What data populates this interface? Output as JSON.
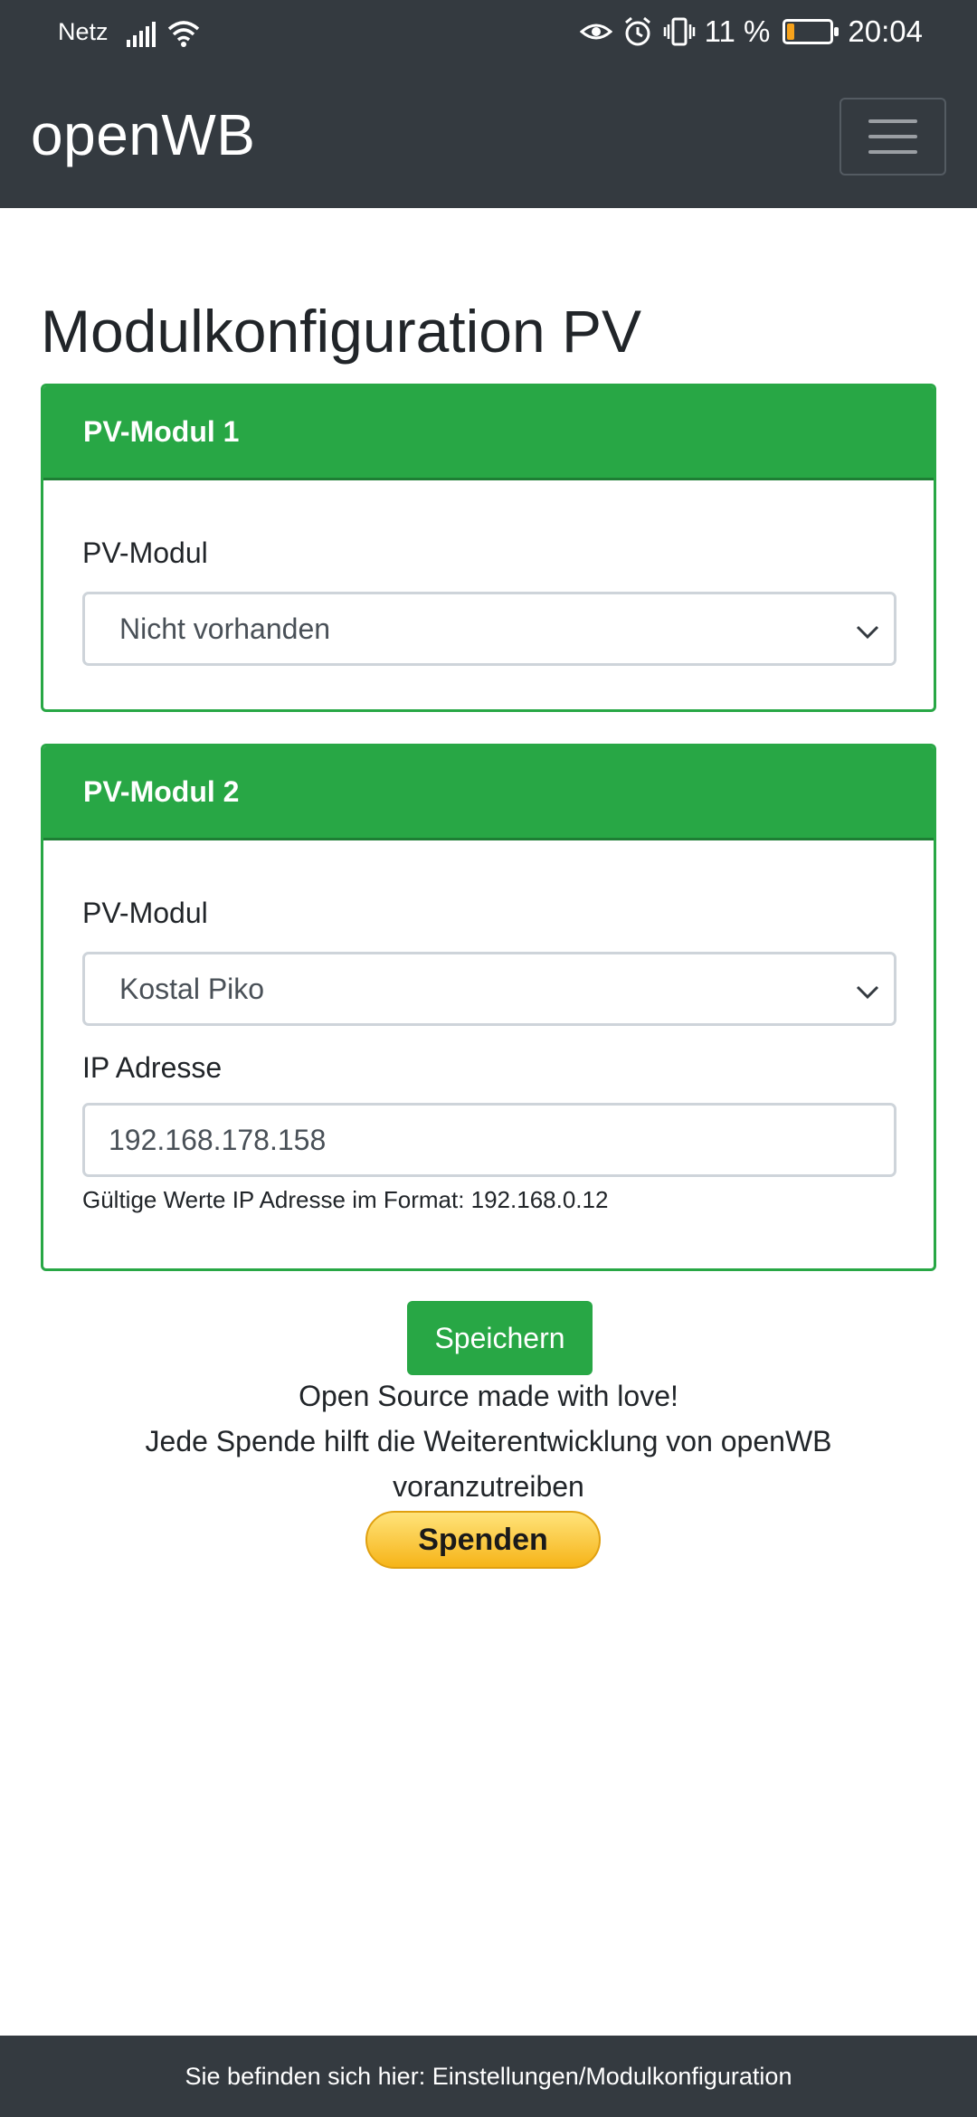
{
  "status_bar": {
    "carrier": "Netz",
    "battery_percent": "11 %",
    "battery_level": 0.11,
    "time": "20:04",
    "icons": [
      "signal-icon",
      "wifi-icon",
      "eye-icon",
      "alarm-icon",
      "vibrate-icon",
      "battery-icon"
    ]
  },
  "navbar": {
    "brand": "openWB",
    "menu_icon": "hamburger-icon"
  },
  "page": {
    "title": "Modulkonfiguration PV"
  },
  "modules": [
    {
      "header": "PV-Modul 1",
      "field_label": "PV-Modul",
      "selected": "Nicht vorhanden"
    },
    {
      "header": "PV-Modul 2",
      "field_label": "PV-Modul",
      "selected": "Kostal Piko",
      "ip_label": "IP Adresse",
      "ip_value": "192.168.178.158",
      "ip_hint": "Gültige Werte IP Adresse im Format: 192.168.0.12"
    }
  ],
  "actions": {
    "save_label": "Speichern"
  },
  "footer": {
    "line1": "Open Source made with love!",
    "line2": "Jede Spende hilft die Weiterentwicklung von openWB",
    "line3": "voranzutreiben",
    "donate_label": "Spenden",
    "breadcrumb": "Sie befinden sich hier: Einstellungen/Modulkonfiguration"
  },
  "colors": {
    "navbar": "#343a40",
    "accent": "#28a745",
    "battery": "#f7a21b"
  }
}
